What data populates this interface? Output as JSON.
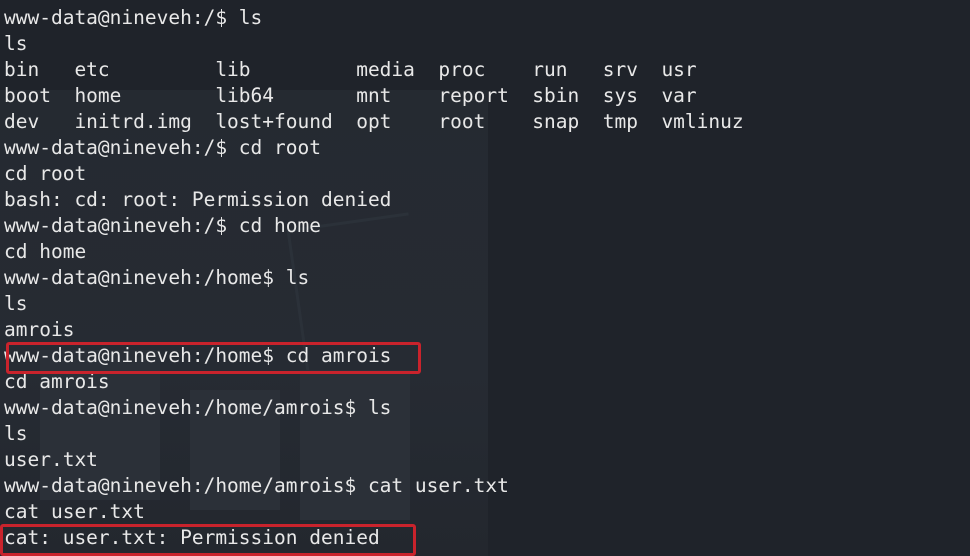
{
  "terminal": {
    "lines": [
      "www-data@nineveh:/$ ls",
      "ls",
      "bin   etc         lib         media  proc    run   srv  usr",
      "boot  home        lib64       mnt    report  sbin  sys  var",
      "dev   initrd.img  lost+found  opt    root    snap  tmp  vmlinuz",
      "www-data@nineveh:/$ cd root",
      "cd root",
      "bash: cd: root: Permission denied",
      "www-data@nineveh:/$ cd home",
      "cd home",
      "www-data@nineveh:/home$ ls",
      "ls",
      "amrois",
      "www-data@nineveh:/home$ cd amrois",
      "cd amrois",
      "www-data@nineveh:/home/amrois$ ls",
      "ls",
      "user.txt",
      "www-data@nineveh:/home/amrois$ cat user.txt",
      "cat user.txt",
      "cat: user.txt: Permission denied"
    ]
  },
  "colors": {
    "background": "#1f232a",
    "text": "#e8e8e8",
    "highlight_border": "#c9232c"
  }
}
